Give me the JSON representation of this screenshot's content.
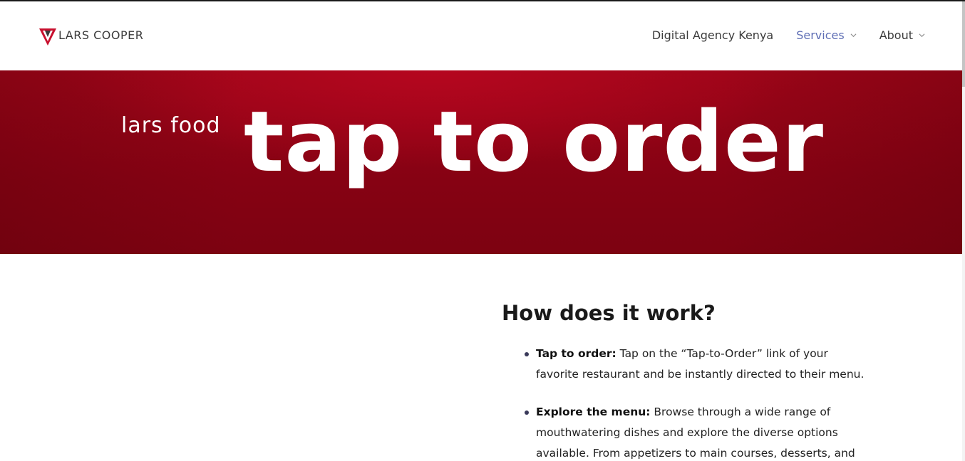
{
  "header": {
    "logo_text": "LARS COOPER",
    "nav": [
      {
        "label": "Digital Agency Kenya",
        "has_dropdown": false,
        "active": false
      },
      {
        "label": "Services",
        "has_dropdown": true,
        "active": true
      },
      {
        "label": "About",
        "has_dropdown": true,
        "active": false
      }
    ]
  },
  "hero": {
    "subtitle": "lars food",
    "title": "tap to order"
  },
  "content": {
    "title": "How does it work?",
    "steps": [
      {
        "label": "Tap to order:",
        "text": " Tap on the “Tap-to-Order” link of your favorite restaurant and be instantly directed to their menu."
      },
      {
        "label": "Explore the menu:",
        "text": " Browse through a wide range of mouthwatering dishes and explore the diverse options available. From appetizers to main courses, desserts, and"
      }
    ]
  },
  "colors": {
    "brand_red": "#9c0518",
    "nav_active": "#5f6fb5",
    "nav_text": "#3a3a3a"
  },
  "icons": {
    "logo": "lars-cooper-v-logo-icon",
    "dropdown": "chevron-down-icon"
  }
}
